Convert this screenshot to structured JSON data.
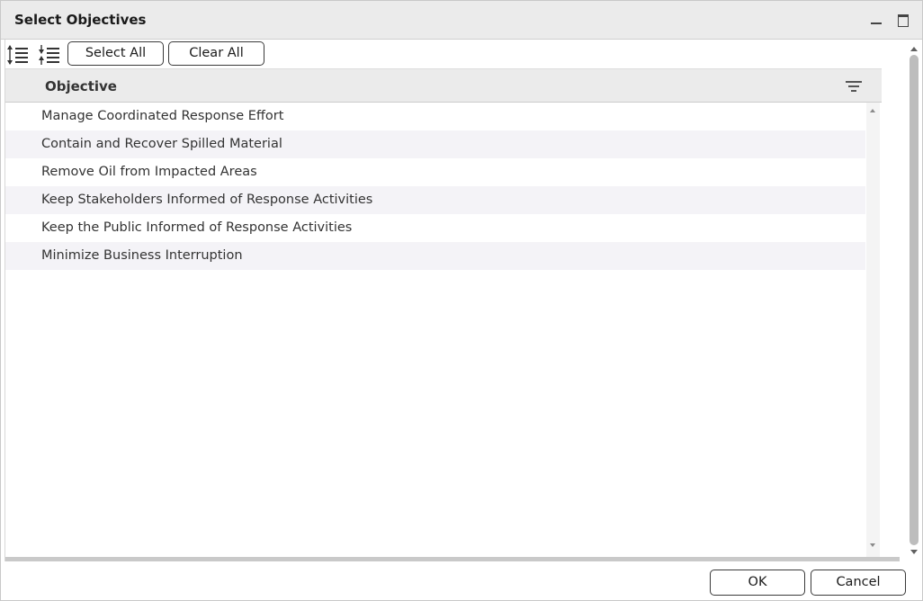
{
  "dialog": {
    "title": "Select Objectives"
  },
  "toolbar": {
    "select_all_label": "Select All",
    "clear_all_label": "Clear All"
  },
  "grid": {
    "column_header": "Objective",
    "rows": [
      "Manage Coordinated Response Effort",
      "Contain and Recover Spilled Material",
      "Remove Oil from Impacted Areas",
      "Keep Stakeholders Informed of Response Activities",
      "Keep the Public Informed of Response Activities",
      "Minimize Business Interruption"
    ]
  },
  "footer": {
    "ok_label": "OK",
    "cancel_label": "Cancel"
  },
  "icons": {
    "expand_all": "expand-all-icon",
    "collapse_all": "collapse-all-icon",
    "filter": "filter-icon",
    "minimize": "minimize-icon",
    "maximize": "maximize-icon"
  },
  "colors": {
    "titlebar": "#ebebeb",
    "header": "#ebebeb",
    "alt_row": "#f4f3f7",
    "scroll_thumb": "#bdbdbd"
  }
}
